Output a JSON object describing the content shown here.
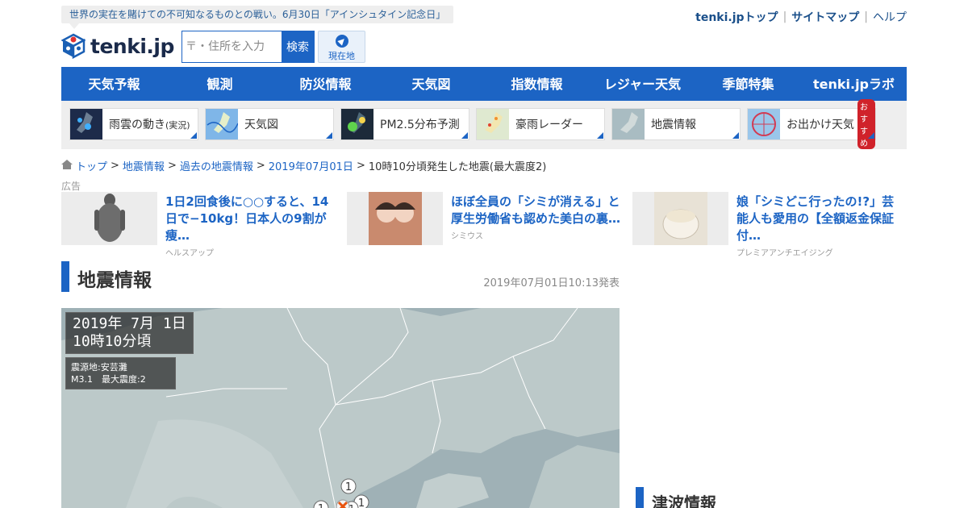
{
  "header": {
    "tagline": "世界の実在を賭けての不可知なるものとの戦い。6月30日「アインシュタイン記念日」",
    "links": [
      "tenki.jpトップ",
      "サイトマップ",
      "ヘルプ"
    ],
    "logo_text": "tenki.jp",
    "search": {
      "placeholder": "〒・住所を入力",
      "button": "検索"
    },
    "location_button": "現在地"
  },
  "nav": [
    "天気予報",
    "観測",
    "防災情報",
    "天気図",
    "指数情報",
    "レジャー天気",
    "季節特集",
    "tenki.jpラボ"
  ],
  "tiles": [
    {
      "label": "雨雲の動き",
      "sub": "(実況)"
    },
    {
      "label": "天気図"
    },
    {
      "label": "PM2.5分布予測"
    },
    {
      "label": "豪雨レーダー"
    },
    {
      "label": "地震情報"
    },
    {
      "label": "お出かけ天気",
      "badge": "おすすめ"
    }
  ],
  "breadcrumb": [
    "トップ",
    "地震情報",
    "過去の地震情報",
    "2019年07月01日",
    "10時10分頃発生した地震(最大震度2)"
  ],
  "ad_label": "広告",
  "ads": [
    {
      "title": "1日2回食後に○○すると、14日で−10kg！日本人の9割が痩…",
      "source": "ヘルスアップ"
    },
    {
      "title": "ほぼ全員の「シミが消える」と厚生労働省も認めた美白の裏…",
      "source": "シミウス"
    },
    {
      "title": "娘「シミどこ行ったの!?」芸能人も愛用の【全額返金保証付…",
      "source": "プレミアアンチエイジング"
    }
  ],
  "section": {
    "title": "地震情報",
    "timestamp": "2019年07月01日10:13発表"
  },
  "map": {
    "date_line1": "2019年  7月  1日",
    "date_line2": "10時10分頃",
    "epicenter": "震源地:安芸灘",
    "magnitude_intensity": "M3.1　最大震度:2",
    "markers": [
      "1",
      "1",
      "1",
      "1"
    ]
  },
  "side": {
    "tsunami_title": "津波情報"
  },
  "colors": {
    "brand_blue": "#1c64c4",
    "nav_text": "#ffffff",
    "badge_red": "#d0222a",
    "sea": "#9fb1b6",
    "land": "#bcc9c9"
  }
}
